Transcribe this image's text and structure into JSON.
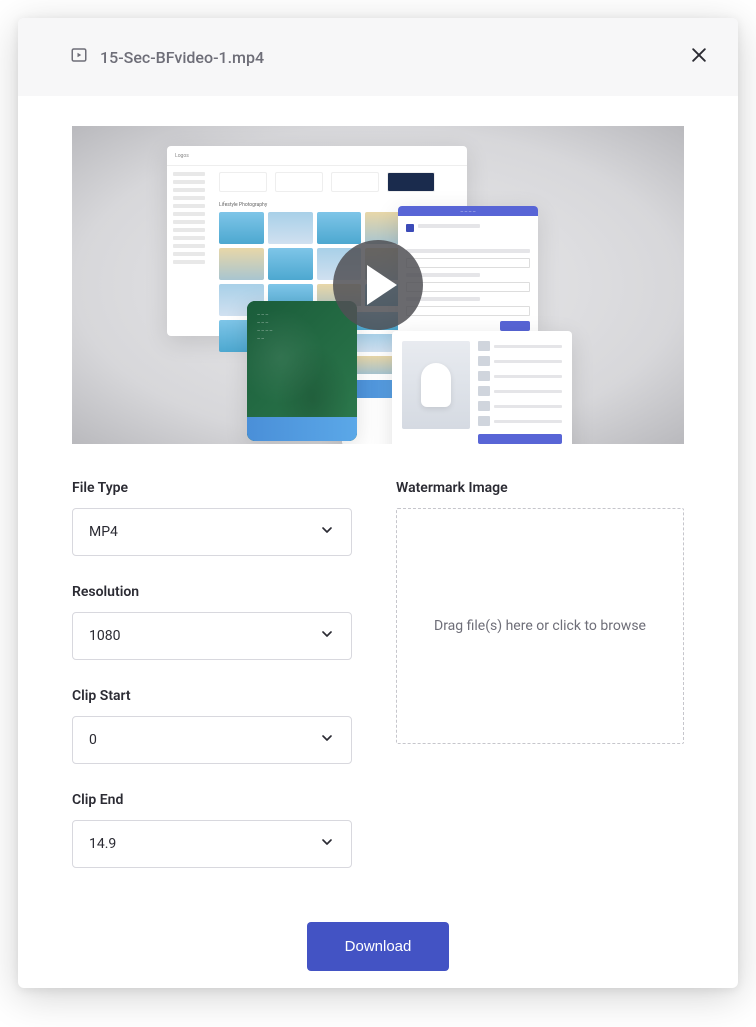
{
  "header": {
    "filename": "15-Sec-BFvideo-1.mp4"
  },
  "form": {
    "file_type": {
      "label": "File Type",
      "value": "MP4"
    },
    "resolution": {
      "label": "Resolution",
      "value": "1080"
    },
    "clip_start": {
      "label": "Clip Start",
      "value": "0"
    },
    "clip_end": {
      "label": "Clip End",
      "value": "14.9"
    },
    "watermark": {
      "label": "Watermark Image",
      "dropzone_text": "Drag file(s) here or click to browse"
    }
  },
  "actions": {
    "download": "Download"
  }
}
